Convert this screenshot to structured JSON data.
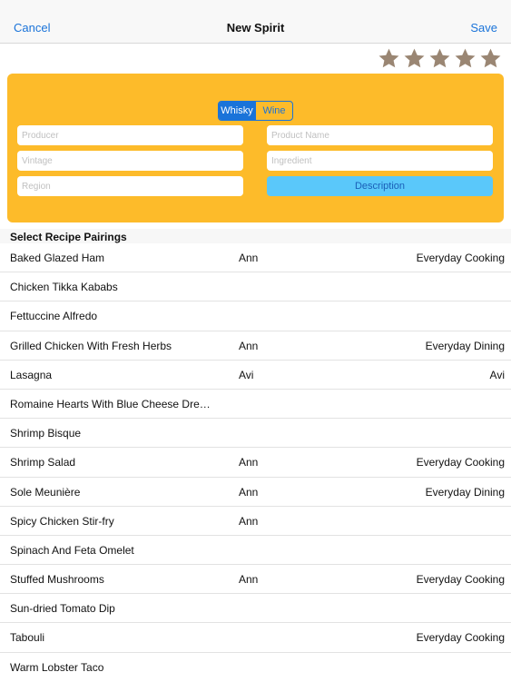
{
  "navbar": {
    "cancel_label": "Cancel",
    "title": "New Spirit",
    "save_label": "Save"
  },
  "rating": {
    "max": 5,
    "value": 0,
    "star_color": "#9a8673"
  },
  "form": {
    "panel_color": "#fdbb2a",
    "segments": [
      {
        "label": "Whisky",
        "selected": true
      },
      {
        "label": "Wine",
        "selected": false
      }
    ],
    "producer_placeholder": "Producer",
    "product_name_placeholder": "Product Name",
    "vintage_placeholder": "Vintage",
    "ingredient_placeholder": "Ingredient",
    "region_placeholder": "Region",
    "description_label": "Description"
  },
  "pairings": {
    "header": "Select Recipe Pairings",
    "rows": [
      {
        "name": "Baked Glazed Ham",
        "author": "Ann",
        "source": "Everyday Cooking"
      },
      {
        "name": "Chicken Tikka Kababs",
        "author": "",
        "source": ""
      },
      {
        "name": "Fettuccine Alfredo",
        "author": "",
        "source": ""
      },
      {
        "name": "Grilled Chicken With Fresh Herbs",
        "author": "Ann",
        "source": "Everyday Dining"
      },
      {
        "name": "Lasagna",
        "author": "Avi",
        "source": "Avi"
      },
      {
        "name": "Romaine Hearts With Blue Cheese Dre…",
        "author": "",
        "source": ""
      },
      {
        "name": "Shrimp Bisque",
        "author": "",
        "source": ""
      },
      {
        "name": "Shrimp Salad",
        "author": "Ann",
        "source": "Everyday Cooking"
      },
      {
        "name": "Sole Meunière",
        "author": "Ann",
        "source": "Everyday Dining"
      },
      {
        "name": "Spicy Chicken Stir-fry",
        "author": "Ann",
        "source": ""
      },
      {
        "name": "Spinach And Feta Omelet",
        "author": "",
        "source": ""
      },
      {
        "name": "Stuffed Mushrooms",
        "author": "Ann",
        "source": "Everyday Cooking"
      },
      {
        "name": "Sun-dried Tomato Dip",
        "author": "",
        "source": ""
      },
      {
        "name": "Tabouli",
        "author": "",
        "source": "Everyday Cooking"
      },
      {
        "name": "Warm Lobster Taco",
        "author": "",
        "source": ""
      }
    ]
  }
}
